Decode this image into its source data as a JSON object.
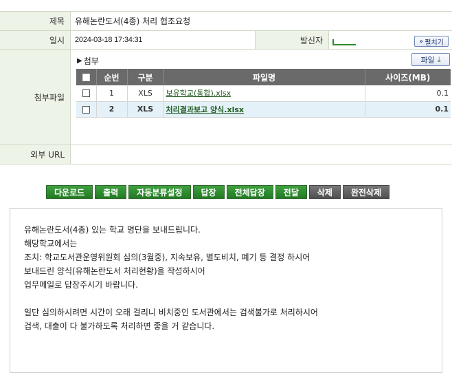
{
  "header": {
    "subject_label": "제목",
    "subject_value": "유해논란도서(4종) 처리 협조요청",
    "datetime_label": "일시",
    "datetime_value": "2024-03-18 17:34:31",
    "sender_label": "발신자",
    "unfold_label": "펼치기"
  },
  "attachments": {
    "row_label": "첨부파일",
    "title": "첨부",
    "file_button_label": "파일",
    "columns": [
      "순번",
      "구분",
      "파일명",
      "사이즈(MB)"
    ],
    "rows": [
      {
        "no": "1",
        "type": "XLS",
        "name": "보유학교(통합).xlsx",
        "size": "0.1"
      },
      {
        "no": "2",
        "type": "XLS",
        "name": "처리결과보고 양식.xlsx",
        "size": "0.1"
      }
    ]
  },
  "external_url": {
    "label": "외부 URL",
    "value": ""
  },
  "actions": {
    "download": "다운로드",
    "print": "출력",
    "auto_classify": "자동분류설정",
    "reply": "답장",
    "reply_all": "전체답장",
    "forward": "전달",
    "delete": "삭제",
    "permanent_delete": "완전삭제"
  },
  "body": {
    "lines": [
      "유해논란도서(4종) 있는 학교 명단을 보내드립니다.",
      "해당학교에서는",
      "조치: 학교도서관운영위원회 심의(3월중), 지속보유, 별도비치, 폐기 등 결정 하시어",
      "보내드린 양식(유해논란도서 처리현황)을 작성하시어",
      "업무메일로 답장주시기 바랍니다.",
      "",
      "일단 심의하시려면 시간이 오래 걸리니 비치중인 도서관에서는 검색불가로 처리하시어",
      "검색, 대출이 다 불가하도록 처리하면 좋을 거 같습니다."
    ]
  }
}
